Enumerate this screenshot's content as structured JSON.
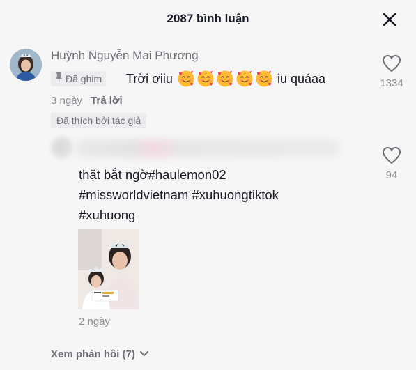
{
  "header": {
    "title": "2087 bình luận",
    "close_icon": "close-icon"
  },
  "comment": {
    "username": "Huỳnh Nguyễn Mai Phương",
    "pinned_label": "Đã ghim",
    "text_start": "Trời ơiiu",
    "emoji_count": 5,
    "emoji_name": "smiling-face-with-hearts",
    "text_end": "iu quáaa",
    "time": "3 ngày",
    "reply_label": "Trả lời",
    "liked_by_author_label": "Đã thích bởi tác giả",
    "like_count": "1334"
  },
  "reply": {
    "lines": [
      "thặt bắt ngờ#haulemon02",
      "#missworldvietnam #xuhuongtiktok",
      "#xuhuong"
    ],
    "time": "2 ngày",
    "like_count": "94"
  },
  "view_replies_label": "Xem phản hồi (7)",
  "colors": {
    "background": "#f6f6f6",
    "primary_text": "#161823",
    "secondary_text": "#8a8b91"
  }
}
